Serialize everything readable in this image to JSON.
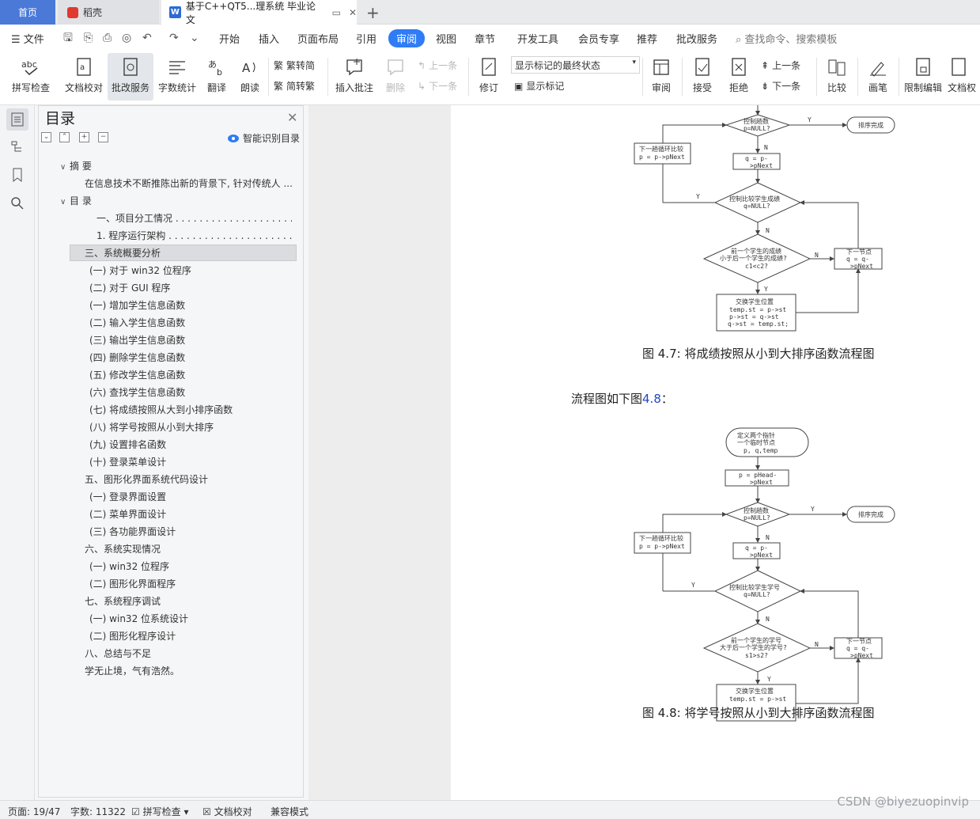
{
  "tabs": {
    "home": "首页",
    "daoke": "稻壳",
    "document": "基于C++QT5...理系统 毕业论文"
  },
  "menu": {
    "file": "文件",
    "items": [
      "开始",
      "插入",
      "页面布局",
      "引用",
      "审阅",
      "视图",
      "章节",
      "开发工具",
      "会员专享",
      "推荐",
      "批改服务"
    ],
    "active": "审阅",
    "search": "查找命令、搜索模板"
  },
  "ribbon": {
    "spell": "拼写检查",
    "doc_check": "文档校对",
    "review_service": "批改服务",
    "word_count": "字数统计",
    "translate": "翻译",
    "read_aloud": "朗读",
    "trad_to_simp": "繁转简",
    "simp_to_trad": "简转繁",
    "insert_comment": "插入批注",
    "delete": "删除",
    "prev": "上一条",
    "next": "下一条",
    "revise": "修订",
    "markup_state": "显示标记的最终状态",
    "show_markup": "显示标记",
    "review": "审阅",
    "accept": "接受",
    "reject": "拒绝",
    "prev2": "上一条",
    "next2": "下一条",
    "compare": "比较",
    "pen": "画笔",
    "restrict": "限制编辑",
    "doc_perm": "文档权"
  },
  "toc": {
    "title": "目录",
    "smart": "智能识别目录",
    "items": [
      {
        "text": "摘 要",
        "caret": "∨"
      },
      {
        "text": "在信息技术不断推陈出新的背景下, 针对传统人 ..."
      },
      {
        "text": "目 录",
        "caret": "∨"
      },
      {
        "text": "一、项目分工情况 . . . . . . . . . . . . . . . . . . . . . . . . . ..."
      },
      {
        "text": "1. 程序运行架构 . . . . . . . . . . . . . . . . . . . . . . . . ..."
      },
      {
        "text": "三、系统概要分析"
      },
      {
        "text": "(一) 对于 win32 位程序"
      },
      {
        "text": "(二) 对于 GUI 程序"
      },
      {
        "text": "(一) 增加学生信息函数"
      },
      {
        "text": "(二) 输入学生信息函数"
      },
      {
        "text": "(三) 输出学生信息函数"
      },
      {
        "text": "(四) 删除学生信息函数"
      },
      {
        "text": "(五) 修改学生信息函数"
      },
      {
        "text": "(六) 查找学生信息函数"
      },
      {
        "text": "(七) 将成绩按照从大到小排序函数"
      },
      {
        "text": "(八) 将学号按照从小到大排序"
      },
      {
        "text": "(九) 设置排名函数"
      },
      {
        "text": "(十) 登录菜单设计"
      },
      {
        "text": "五、图形化界面系统代码设计"
      },
      {
        "text": "(一) 登录界面设置"
      },
      {
        "text": "(二) 菜单界面设计"
      },
      {
        "text": "(三) 各功能界面设计"
      },
      {
        "text": "六、系统实现情况"
      },
      {
        "text": "(一) win32 位程序"
      },
      {
        "text": "(二) 图形化界面程序"
      },
      {
        "text": "七、系统程序调试"
      },
      {
        "text": "(一) win32 位系统设计"
      },
      {
        "text": "(二) 图形化程序设计"
      },
      {
        "text": "八、总结与不足"
      },
      {
        "text": "学无止境，气有浩然。"
      }
    ]
  },
  "document": {
    "caption1": "图 4.7: 将成绩按照从小到大排序函数流程图",
    "para_prefix": "流程图如下图",
    "para_ref": "4.8",
    "para_suffix": "：",
    "caption2": "图 4.8: 将学号按照从小到大排序函数流程图",
    "fc1": {
      "loop": [
        "控制趟数",
        "p=NULL?"
      ],
      "done": "排序完成",
      "next_round": [
        "下一趟循环比较",
        "p = p->pNext"
      ],
      "q_assign": [
        "q = p-",
        ">pNext"
      ],
      "inner": [
        "控制比较学生成绩",
        "q=NULL?"
      ],
      "compare": [
        "前一个学生的成绩",
        "小于后一个学生的成绩?",
        "c1<c2?"
      ],
      "next_node": [
        "下一节点",
        "q = q-",
        ">pNext"
      ],
      "swap": [
        "交换学生位置",
        "temp.st = p->st",
        "p->st = q->st",
        "q->st = temp.st;"
      ],
      "y": "Y",
      "n": "N"
    },
    "fc2": {
      "start": [
        "定义两个指针",
        "一个临时节点",
        "p, q,temp"
      ],
      "p_assign": [
        "p = pHead-",
        ">pNext"
      ],
      "loop": [
        "控制趟数",
        "p=NULL?"
      ],
      "done": "排序完成",
      "next_round": [
        "下一趟循环比较",
        "p = p->pNext"
      ],
      "q_assign": [
        "q = p-",
        ">pNext"
      ],
      "inner": [
        "控制比较学生学号",
        "q=NULL?"
      ],
      "compare": [
        "前一个学生的学号",
        "大于后一个学生的学号?",
        "s1>s2?"
      ],
      "next_node": [
        "下一节点",
        "q = q-",
        ">pNext"
      ],
      "swap": [
        "交换学生位置",
        "temp.st = p->st"
      ],
      "y": "Y",
      "n": "N"
    }
  },
  "status": {
    "page": "页面: 19/47",
    "words": "字数: 11322",
    "spell": "拼写检查",
    "doc_check": "文档校对",
    "compat": "兼容模式"
  },
  "watermark": "CSDN @biyezuopinvip",
  "colors": {
    "accent": "#2f7cf6",
    "home_tab": "#4a79d8",
    "link": "#2244cc"
  }
}
